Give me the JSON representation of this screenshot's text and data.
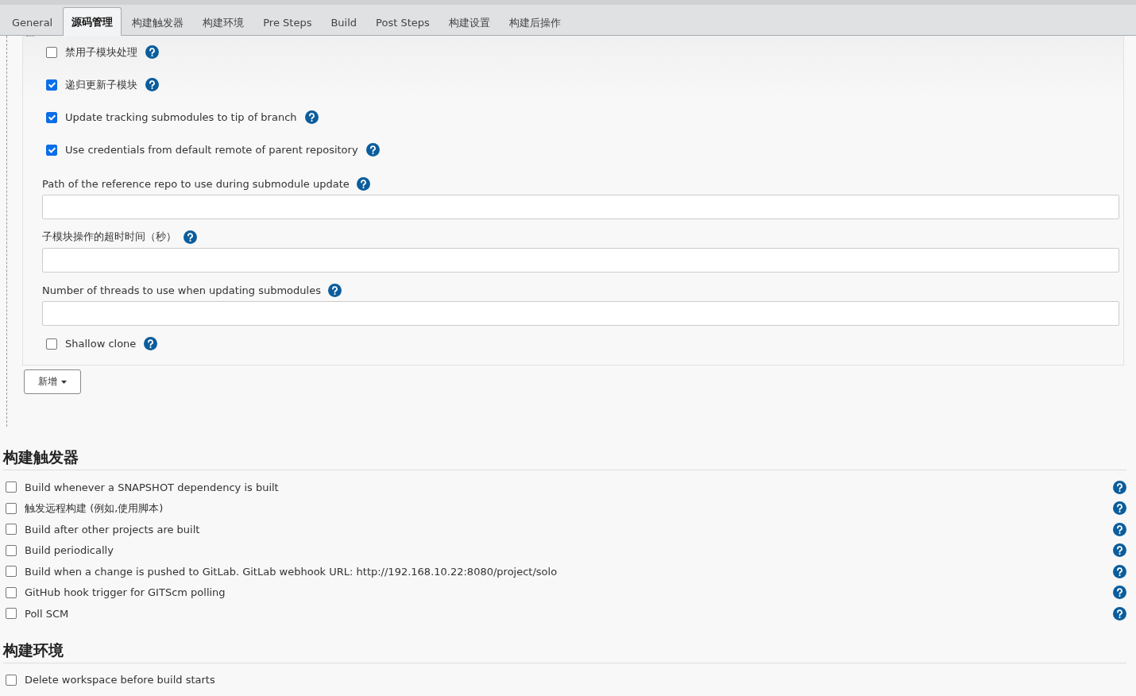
{
  "tabs": [
    {
      "label": "General",
      "selected": false
    },
    {
      "label": "源码管理",
      "selected": true
    },
    {
      "label": "构建触发器",
      "selected": false
    },
    {
      "label": "构建环境",
      "selected": false
    },
    {
      "label": "Pre Steps",
      "selected": false
    },
    {
      "label": "Build",
      "selected": false
    },
    {
      "label": "Post Steps",
      "selected": false
    },
    {
      "label": "构建设置",
      "selected": false
    },
    {
      "label": "构建后操作",
      "selected": false
    }
  ],
  "submodule_options": [
    {
      "kind": "checkbox",
      "label": "禁用子模块处理",
      "checked": false
    },
    {
      "kind": "checkbox",
      "label": "递归更新子模块",
      "checked": true
    },
    {
      "kind": "checkbox",
      "label": "Update tracking submodules to tip of branch",
      "checked": true
    },
    {
      "kind": "checkbox",
      "label": "Use credentials from default remote of parent repository",
      "checked": true
    },
    {
      "kind": "field",
      "label": "Path of the reference repo to use during submodule update"
    },
    {
      "kind": "field",
      "label": "子模块操作的超时时间（秒）"
    },
    {
      "kind": "field",
      "label": "Number of threads to use when updating submodules"
    },
    {
      "kind": "checkbox",
      "label": "Shallow clone",
      "checked": false
    }
  ],
  "add_button": {
    "label": "新增"
  },
  "sections": [
    {
      "title": "构建触发器",
      "options": [
        {
          "label": "Build whenever a SNAPSHOT dependency is built",
          "checked": false
        },
        {
          "label": "触发远程构建 (例如,使用脚本)",
          "checked": false
        },
        {
          "label": "Build after other projects are built",
          "checked": false
        },
        {
          "label": "Build periodically",
          "checked": false
        },
        {
          "label": "Build when a change is pushed to GitLab. GitLab webhook URL: http://192.168.10.22:8080/project/solo",
          "checked": false
        },
        {
          "label": "GitHub hook trigger for GITScm polling",
          "checked": false
        },
        {
          "label": "Poll SCM",
          "checked": false
        }
      ]
    },
    {
      "title": "构建环境",
      "options": [
        {
          "label": "Delete workspace before build starts",
          "checked": false
        }
      ]
    }
  ]
}
